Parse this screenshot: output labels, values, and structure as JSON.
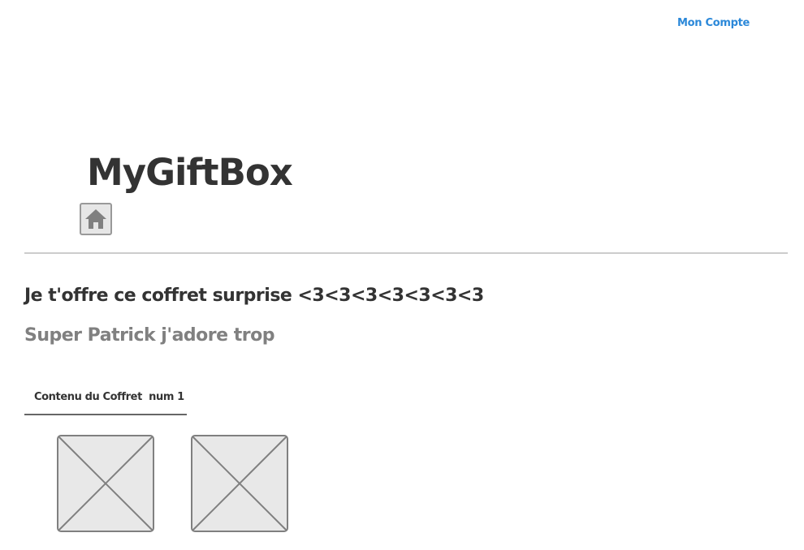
{
  "header": {
    "account_link": "Mon Compte"
  },
  "brand": {
    "logo_text": "MyGiftBox",
    "home_icon": "home-icon"
  },
  "gift": {
    "title": "Je t'offre ce coffret surprise <3<3<3<3<3<3<3",
    "message": "Super Patrick j'adore trop"
  },
  "tabs": [
    {
      "label": "Contenu du Coffret  num 1"
    }
  ],
  "contents": {
    "items": [
      {
        "icon": "image-placeholder-icon"
      },
      {
        "icon": "image-placeholder-icon"
      }
    ]
  },
  "colors": {
    "link": "#2b88d9",
    "title": "#333333",
    "subtitle": "#808080",
    "placeholder_fill": "#e8e8e8",
    "placeholder_stroke": "#808080"
  }
}
